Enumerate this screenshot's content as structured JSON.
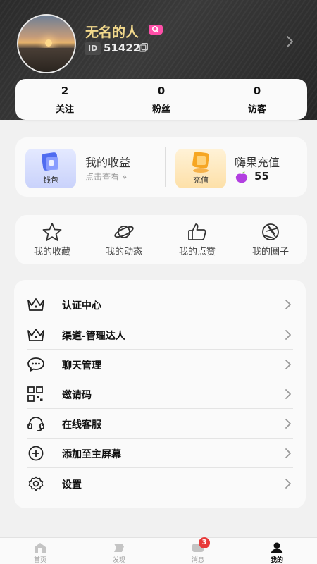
{
  "profile": {
    "nickname": "无名的人",
    "id_label": "ID",
    "id_value": "51422"
  },
  "stats": [
    {
      "value": "2",
      "label": "关注"
    },
    {
      "value": "0",
      "label": "粉丝"
    },
    {
      "value": "0",
      "label": "访客"
    }
  ],
  "wallet": {
    "wallet_tile_label": "钱包",
    "income_title": "我的收益",
    "income_sub": "点击查看 »",
    "recharge_tile_label": "充值",
    "recharge_title": "嗨果充值",
    "balance": "55"
  },
  "shortcuts": [
    {
      "label": "我的收藏",
      "icon": "star-icon"
    },
    {
      "label": "我的动态",
      "icon": "planet-icon"
    },
    {
      "label": "我的点赞",
      "icon": "thumbs-up-icon"
    },
    {
      "label": "我的圈子",
      "icon": "aperture-icon"
    }
  ],
  "menu": [
    {
      "label": "认证中心",
      "icon": "crown-icon"
    },
    {
      "label": "渠道-管理达人",
      "icon": "crown-icon"
    },
    {
      "label": "聊天管理",
      "icon": "chat-icon"
    },
    {
      "label": "邀请码",
      "icon": "qr-code-icon"
    },
    {
      "label": "在线客服",
      "icon": "headset-icon"
    },
    {
      "label": "添加至主屏幕",
      "icon": "plus-circle-icon"
    },
    {
      "label": "设置",
      "icon": "gear-icon"
    }
  ],
  "tabbar": {
    "items": [
      {
        "label": "首页",
        "icon": "home-icon"
      },
      {
        "label": "发现",
        "icon": "discover-icon"
      },
      {
        "label": "消息",
        "icon": "message-icon"
      },
      {
        "label": "我的",
        "icon": "profile-icon"
      }
    ],
    "message_badge": "3",
    "active": "我的"
  },
  "colors": {
    "nickname": "#f2d98c",
    "badge_pink": "#ff4fa8",
    "badge_red": "#e83b3b",
    "peach_purple": "#b23fe0"
  }
}
